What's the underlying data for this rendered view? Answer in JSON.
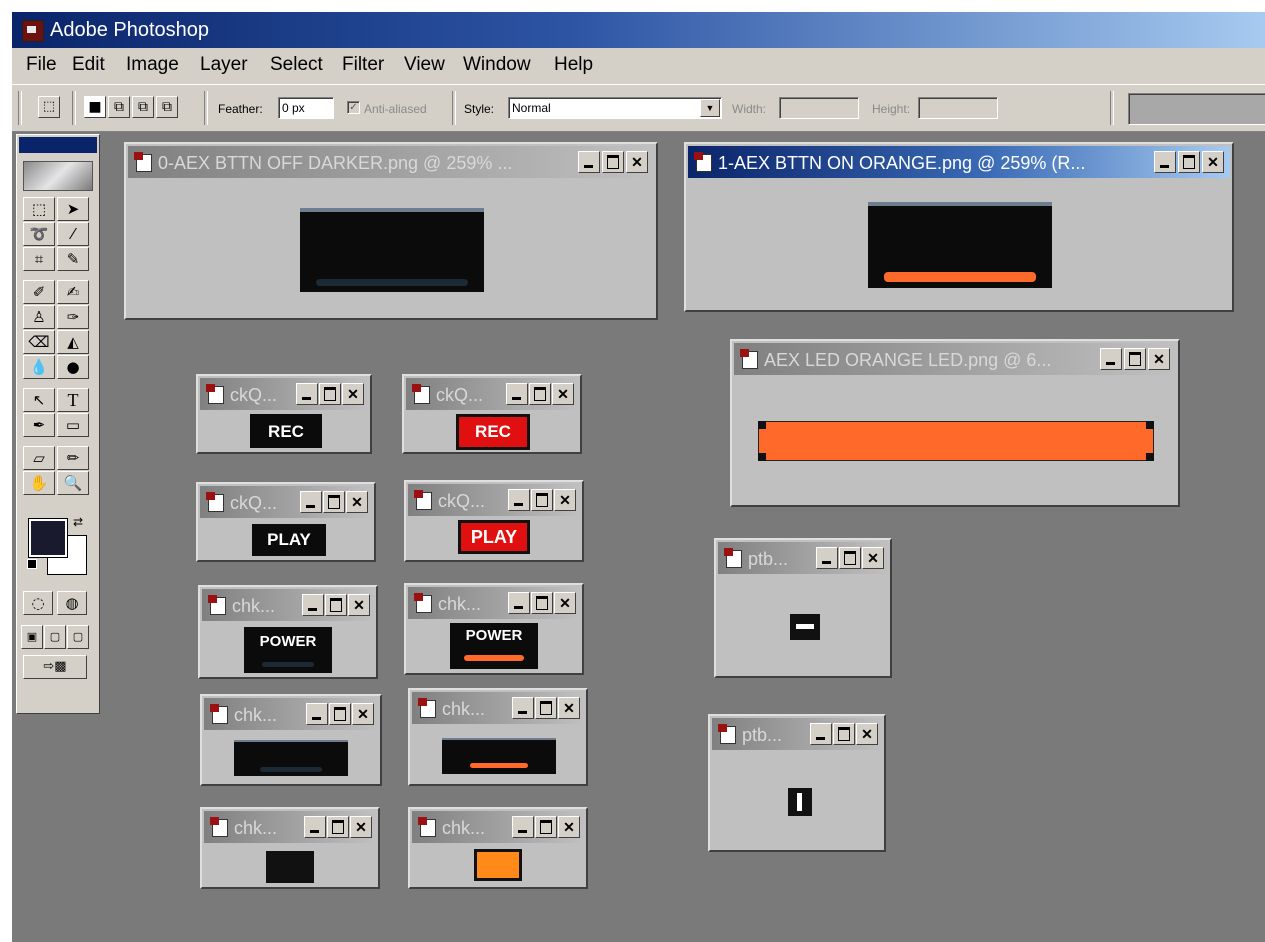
{
  "app": {
    "title": "Adobe Photoshop"
  },
  "menu": [
    "File",
    "Edit",
    "Image",
    "Layer",
    "Select",
    "Filter",
    "View",
    "Window",
    "Help"
  ],
  "options": {
    "feather_label": "Feather:",
    "feather_value": "0 px",
    "antialias_label": "Anti-aliased",
    "antialias_checked": true,
    "style_label": "Style:",
    "style_value": "Normal",
    "width_label": "Width:",
    "height_label": "Height:"
  },
  "windows": {
    "w1": {
      "title": "0-AEX BTTN OFF DARKER.png @ 259% ..."
    },
    "w2": {
      "title": "1-AEX BTTN ON ORANGE.png @ 259% (R..."
    },
    "w3": {
      "title": "AEX LED ORANGE LED.png @ 6..."
    },
    "rec_off": {
      "title": "ckQ...",
      "label": "REC"
    },
    "rec_on": {
      "title": "ckQ...",
      "label": "REC"
    },
    "play_off": {
      "title": "ckQ...",
      "label": "PLAY"
    },
    "play_on": {
      "title": "ckQ...",
      "label": "PLAY"
    },
    "power_off": {
      "title": "chk...",
      "label": "POWER"
    },
    "power_on": {
      "title": "chk...",
      "label": "POWER"
    },
    "bar_off": {
      "title": "chk..."
    },
    "bar_on": {
      "title": "chk..."
    },
    "sq_off": {
      "title": "chk..."
    },
    "sq_on": {
      "title": "chk..."
    },
    "ptb1": {
      "title": "ptb..."
    },
    "ptb2": {
      "title": "ptb..."
    }
  },
  "colors": {
    "orange": "#ff6a2a",
    "led_orange": "#ff6a2a",
    "red_button": "#e01010",
    "dark_button": "#0b0b0b",
    "foreground": "#1a1a2e",
    "background": "#ffffff",
    "square_orange": "#ff8a1a"
  },
  "icons": {
    "tools": [
      "marquee-icon",
      "move-icon",
      "lasso-icon",
      "magic-wand-icon",
      "crop-icon",
      "slice-icon",
      "healing-brush-icon",
      "brush-icon",
      "clone-stamp-icon",
      "history-brush-icon",
      "eraser-icon",
      "paint-bucket-icon",
      "blur-icon",
      "dodge-icon",
      "path-selection-icon",
      "type-icon",
      "pen-icon",
      "shape-icon",
      "notes-icon",
      "eyedropper-icon",
      "hand-icon",
      "zoom-icon"
    ]
  }
}
